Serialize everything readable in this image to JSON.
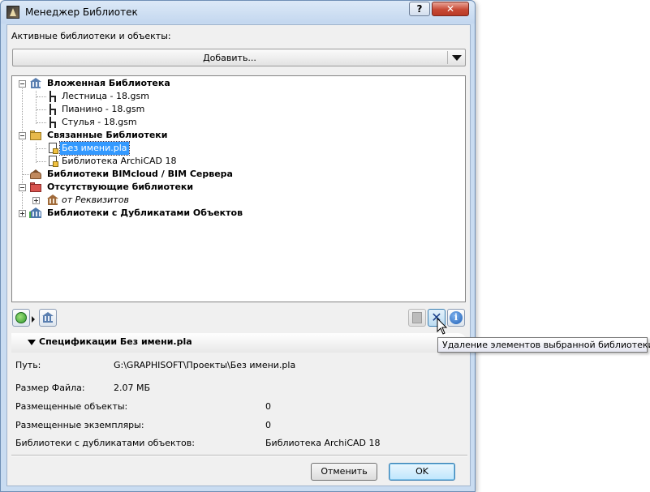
{
  "window": {
    "title": "Менеджер Библиотек",
    "help_label": "?",
    "close_label": "✕"
  },
  "active_label": "Активные библиотеки и объекты:",
  "add_button": "Добавить...",
  "tree": {
    "embedded": {
      "label": "Вложенная Библиотека",
      "items": [
        "Лестница - 18.gsm",
        "Пианино - 18.gsm",
        "Стулья - 18.gsm"
      ]
    },
    "linked": {
      "label": "Связанные Библиотеки",
      "items": [
        "Без имени.pla",
        "Библиотека ArchiCAD 18"
      ]
    },
    "bimcloud": {
      "label": "Библиотеки BIMcloud / BIM Сервера"
    },
    "missing": {
      "label": "Отсутствующие библиотеки",
      "items": [
        "от Реквизитов"
      ]
    },
    "duplicates": {
      "label": "Библиотеки с Дубликатами Объектов"
    }
  },
  "toolbar": {
    "info_glyph": "i",
    "delete_glyph": "✕"
  },
  "tooltip": "Удаление элементов выбранной библиотеки",
  "specs": {
    "title": "Спецификации Без имени.pla",
    "path_label": "Путь:",
    "path_value": "G:\\GRAPHISOFT\\Проекты\\Без имени.pla",
    "size_label": "Размер Файла:",
    "size_value": "2.07 МБ",
    "placed_objects_label": "Размещенные объекты:",
    "placed_objects_value": "0",
    "placed_instances_label": "Размещенные экземпляры:",
    "placed_instances_value": "0",
    "dupe_libs_label": "Библиотеки с дубликатами объектов:",
    "dupe_libs_value": "Библиотека ArchiCAD 18"
  },
  "buttons": {
    "cancel": "Отменить",
    "ok": "OK"
  },
  "colors": {
    "selection": "#3399ff",
    "frame": "#c9dcf1",
    "close": "#c84a36"
  }
}
